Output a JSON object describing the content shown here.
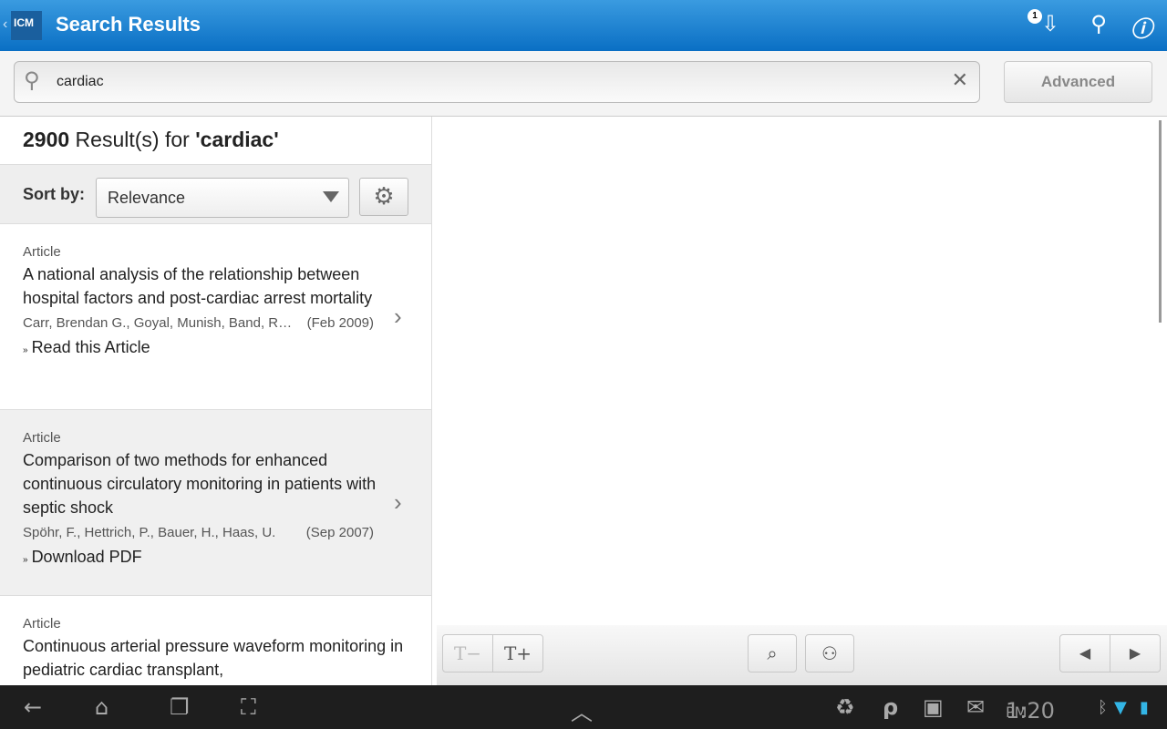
{
  "header": {
    "logo": "ICM",
    "title": "Search Results",
    "downloads_badge": "1"
  },
  "search": {
    "value": "cardiac",
    "advanced_label": "Advanced"
  },
  "results": {
    "count": "2900",
    "label": " Result(s) for ",
    "query": "'cardiac'",
    "sort_label": "Sort by:",
    "sort_value": "Relevance",
    "items": [
      {
        "type": "Article",
        "title": "A national analysis of the relationship between hospital factors and post-cardiac arrest mortality",
        "authors": "Carr, Brendan G., Goyal, Munish, Band, Rose A., Gaieski, David F.",
        "date": "(Feb 2009)",
        "action": "Read this Article"
      },
      {
        "type": "Article",
        "title": "Comparison of two methods for enhanced continuous circulatory monitoring in patients with septic shock",
        "authors": "Spöhr, F., Hettrich, P., Bauer, H., Haas, U.",
        "date": "(Sep 2007)",
        "action": "Download PDF"
      },
      {
        "type": "Article",
        "title": "Continuous arterial pressure waveform monitoring in pediatric cardiac transplant,",
        "authors": "",
        "date": "",
        "action": ""
      }
    ]
  },
  "toolbar": {
    "text_smaller": "T−",
    "text_larger": "T+"
  },
  "status": {
    "time": "1:20",
    "ampm": "PM"
  }
}
